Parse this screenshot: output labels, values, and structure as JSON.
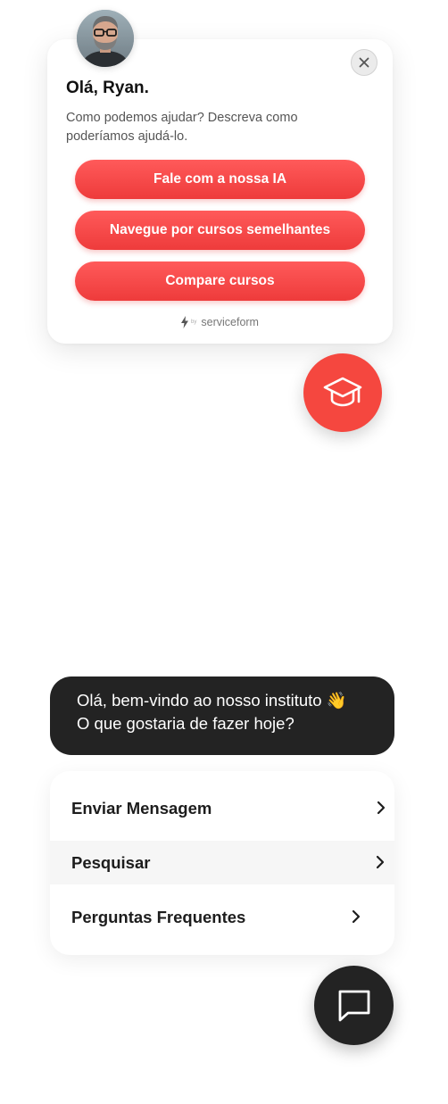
{
  "welcome_card": {
    "greeting": "Olá, Ryan.",
    "subtitle": "Como podemos ajudar? Descreva como poderíamos ajudá-lo.",
    "buttons": [
      {
        "label": "Fale com a nossa IA"
      },
      {
        "label": "Navegue por cursos semelhantes"
      },
      {
        "label": "Compare cursos"
      }
    ],
    "powered_by": {
      "prefix": "by",
      "brand": "serviceform"
    }
  },
  "chat_widget": {
    "welcome_line1": "Olá, bem-vindo ao nosso instituto 👋",
    "welcome_line2": "O que gostaria de fazer hoje?",
    "menu": [
      {
        "label": "Enviar Mensagem"
      },
      {
        "label": "Pesquisar"
      },
      {
        "label": "Perguntas Frequentes"
      }
    ]
  },
  "colors": {
    "accent_red": "#f5473f",
    "dark": "#232323"
  },
  "icons": {
    "close": "close-icon",
    "launcher": "graduation-cap-icon",
    "chat": "chat-bubble-icon",
    "chevron": "chevron-right-icon",
    "bolt": "bolt-icon"
  }
}
